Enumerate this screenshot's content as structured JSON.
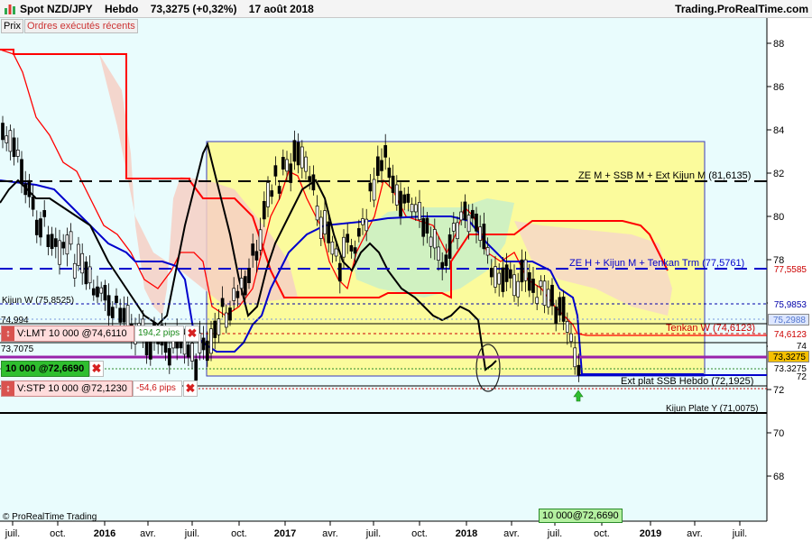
{
  "header": {
    "instrument": "Spot NZD/JPY",
    "timeframe": "Hebdo",
    "price": "73,3275 (+0,32%)",
    "date": "17 août 2018",
    "brand": "Trading.ProRealTime.com"
  },
  "tabs": [
    "Prix",
    "Ordres exécutés récents"
  ],
  "y_axis": {
    "ticks": [
      "88",
      "86",
      "84",
      "82",
      "80",
      "78",
      "76",
      "74",
      "72",
      "70",
      "68"
    ]
  },
  "x_axis": {
    "labels": [
      "juil.",
      "oct.",
      "2016",
      "avr.",
      "juil.",
      "oct.",
      "2017",
      "avr.",
      "juil.",
      "oct.",
      "2018",
      "avr.",
      "juil.",
      "oct.",
      "2019",
      "avr.",
      "juil."
    ]
  },
  "annotations": {
    "ze_m": "ZE M + SSB M + Ext Kijun M  (81,6135)",
    "ze_h": "ZE H + Kijun M + Tenkan Trm (77,5761)",
    "kijun_w": "Kijun W (75,8525)",
    "tenkan_w": "Tenkan W (74,6123)",
    "ext_plat": "Ext plat SSB Hebdo (72,1925)",
    "kijun_plate": "Kijun Plate Y (71,0075)",
    "level_74994": "74,994",
    "level_737075": "73,7075"
  },
  "price_tags": [
    {
      "value": "77,5585",
      "color": "#cc0000",
      "bg": "#ffffff"
    },
    {
      "value": "75,9853",
      "color": "#0000aa",
      "bg": "#ffffff"
    },
    {
      "value": "75,2988",
      "color": "#5577cc",
      "bg": "#dde6ff"
    },
    {
      "value": "74,6123",
      "color": "#cc0000",
      "bg": "#ffffff"
    },
    {
      "value": "74",
      "color": "#000000",
      "bg": "#ffffff"
    },
    {
      "value": "73,3275",
      "color": "#000000",
      "bg": "#f5c000"
    },
    {
      "value": "73,3275",
      "color": "#000000",
      "bg": "#ffffff"
    },
    {
      "value": "72",
      "color": "#000000",
      "bg": "#ffffff"
    }
  ],
  "orders": {
    "limit": {
      "label": "V:LMT 10 000 @74,6110",
      "pips": "194,2 pips"
    },
    "position": {
      "label": "10 000 @72,6690"
    },
    "stop": {
      "label": "V:STP 10 000 @72,1230",
      "pips": "-54,6 pips"
    }
  },
  "bottom_marker": "10 000@72,6690",
  "copyright": "© ProRealTime Trading",
  "colors": {
    "yellow_zone": "#ffff99",
    "bg_cyan": "#e6fbfc",
    "tenkan": "#ff0000",
    "kijun": "#0000cc",
    "price_line": "#000000",
    "cloud_red": "#f8c8c0",
    "cloud_green": "#c8f0c8"
  }
}
